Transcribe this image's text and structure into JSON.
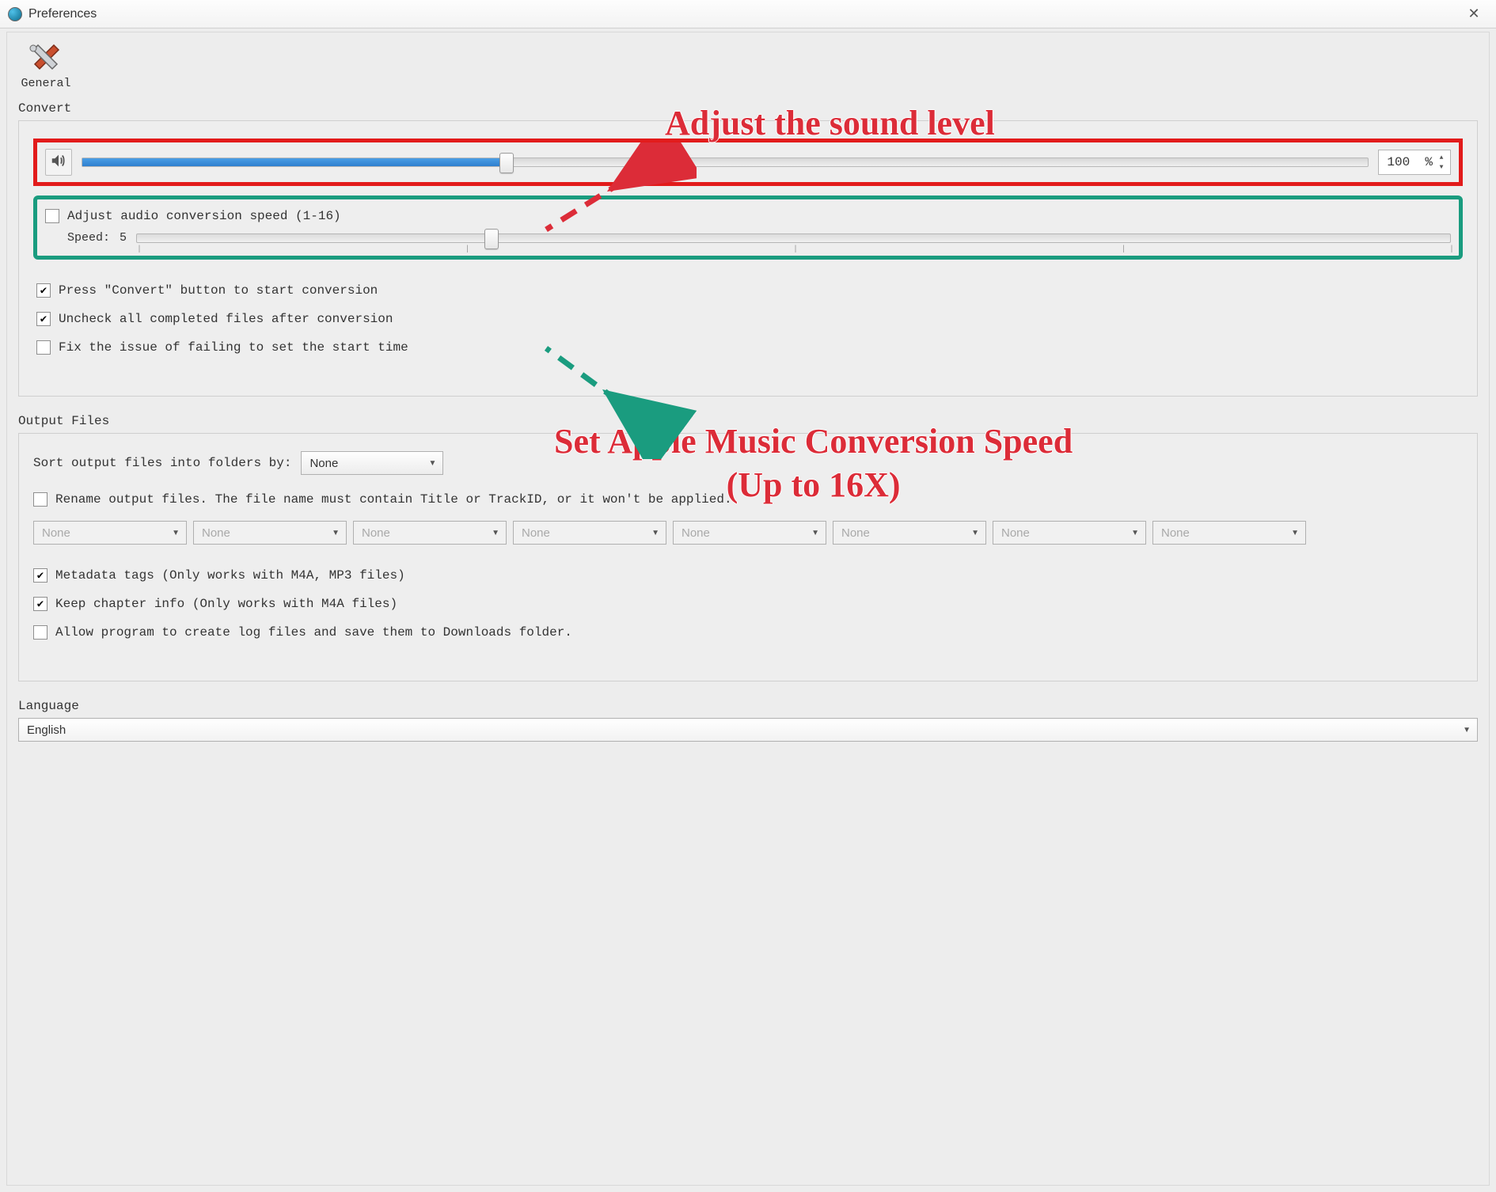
{
  "window": {
    "title": "Preferences"
  },
  "tab": {
    "general": "General"
  },
  "convert": {
    "label": "Convert",
    "volume_percent": 33,
    "volume_value": "100",
    "volume_suffix": "%",
    "speed_checkbox": false,
    "speed_label": "Adjust audio conversion speed (1-16)",
    "speed_prefix": "Speed:",
    "speed_value": "5",
    "speed_max": 16,
    "speed_pos_percent": 27,
    "press_convert": {
      "checked": true,
      "label": "Press \"Convert\" button to start conversion"
    },
    "uncheck_completed": {
      "checked": true,
      "label": "Uncheck all completed files after conversion"
    },
    "fix_start_time": {
      "checked": false,
      "label": "Fix the issue of failing to set the start time"
    }
  },
  "output": {
    "label": "Output Files",
    "sort_label": "Sort output files into folders by:",
    "sort_value": "None",
    "rename": {
      "checked": false,
      "label": "Rename output files. The file name must contain Title or TrackID, or it won't be applied."
    },
    "rename_fields": [
      "None",
      "None",
      "None",
      "None",
      "None",
      "None",
      "None",
      "None"
    ],
    "metadata": {
      "checked": true,
      "label": "Metadata tags (Only works with M4A, MP3 files)"
    },
    "chapter": {
      "checked": true,
      "label": "Keep chapter info (Only works with M4A files)"
    },
    "logs": {
      "checked": false,
      "label": "Allow program to create log files and save them to Downloads folder."
    }
  },
  "language": {
    "label": "Language",
    "value": "English"
  },
  "annotations": {
    "a1": "Adjust the sound level",
    "a2_line1": "Set Apple Music Conversion Speed",
    "a2_line2": "(Up to 16X)"
  }
}
